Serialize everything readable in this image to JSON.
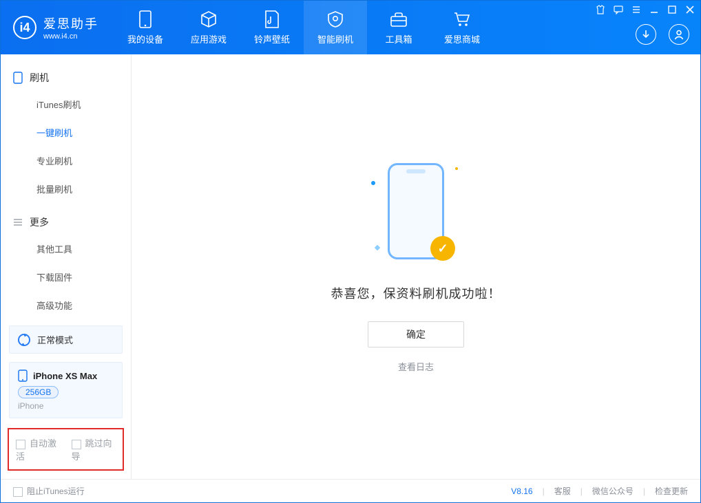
{
  "app": {
    "name": "爱思助手",
    "site": "www.i4.cn"
  },
  "nav": {
    "tabs": [
      {
        "label": "我的设备",
        "icon": "device"
      },
      {
        "label": "应用游戏",
        "icon": "cube"
      },
      {
        "label": "铃声壁纸",
        "icon": "music"
      },
      {
        "label": "智能刷机",
        "icon": "gear",
        "active": true
      },
      {
        "label": "工具箱",
        "icon": "toolbox"
      },
      {
        "label": "爱思商城",
        "icon": "cart"
      }
    ]
  },
  "sidebar": {
    "section_flash": "刷机",
    "flash_items": [
      {
        "label": "iTunes刷机"
      },
      {
        "label": "一键刷机",
        "active": true
      },
      {
        "label": "专业刷机"
      },
      {
        "label": "批量刷机"
      }
    ],
    "section_more": "更多",
    "more_items": [
      {
        "label": "其他工具"
      },
      {
        "label": "下载固件"
      },
      {
        "label": "高级功能"
      }
    ]
  },
  "device_mode": {
    "label": "正常模式"
  },
  "device": {
    "name": "iPhone XS Max",
    "capacity": "256GB",
    "type": "iPhone"
  },
  "options": {
    "auto_activate": "自动激活",
    "skip_guide": "跳过向导"
  },
  "main": {
    "success_message": "恭喜您，保资料刷机成功啦！",
    "ok_button": "确定",
    "view_log": "查看日志"
  },
  "footer": {
    "block_itunes": "阻止iTunes运行",
    "version": "V8.16",
    "support": "客服",
    "wechat": "微信公众号",
    "update": "检查更新"
  }
}
